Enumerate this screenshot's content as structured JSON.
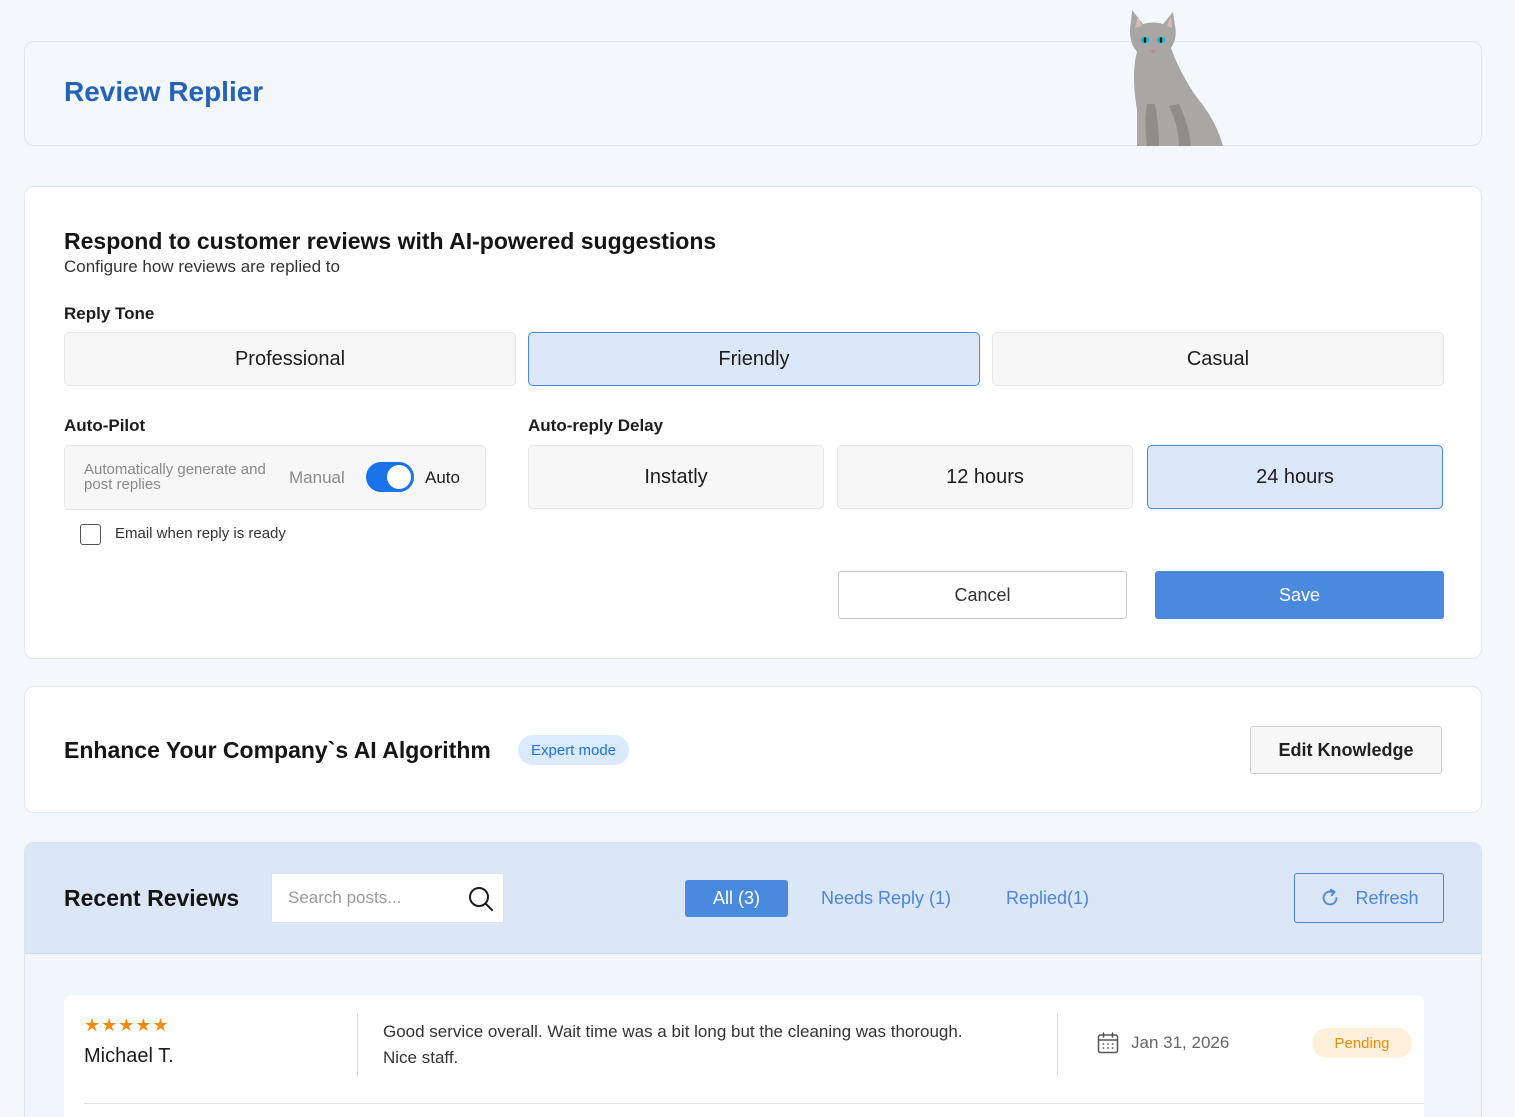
{
  "header": {
    "title": "Review Replier"
  },
  "settings": {
    "title": "Respond to customer reviews with AI-powered suggestions",
    "subtitle": "Configure how reviews are replied to",
    "reply_tone": {
      "label": "Reply Tone",
      "options": [
        "Professional",
        "Friendly",
        "Casual"
      ],
      "selected": "Friendly"
    },
    "auto_pilot": {
      "label": "Auto-Pilot",
      "description": "Automatically generate and post replies",
      "manual_label": "Manual",
      "auto_label": "Auto",
      "enabled": true
    },
    "auto_reply_delay": {
      "label": "Auto-reply Delay",
      "options": [
        "Instatly",
        "12 hours",
        "24 hours"
      ],
      "selected": "24 hours"
    },
    "email_option": {
      "label": "Email when reply is ready",
      "checked": false
    },
    "cancel_label": "Cancel",
    "save_label": "Save"
  },
  "enhance": {
    "title": "Enhance Your Company`s AI Algorithm",
    "badge": "Expert mode",
    "edit_button": "Edit Knowledge"
  },
  "reviews": {
    "title": "Recent Reviews",
    "search_placeholder": "Search posts...",
    "tabs": [
      {
        "label": "All (3)",
        "active": true
      },
      {
        "label": "Needs Reply (1)",
        "active": false
      },
      {
        "label": "Replied(1)",
        "active": false
      }
    ],
    "refresh_label": "Refresh",
    "items": [
      {
        "rating": 5,
        "stars": "★★★★★",
        "author": "Michael T.",
        "text": "Good service overall. Wait time was a bit long but the cleaning was thorough. Nice staff.",
        "date": "Jan 31, 2026",
        "status": "Pending"
      }
    ]
  },
  "colors": {
    "brand_blue": "#2563b8",
    "accent": "#4a8ade",
    "selected_bg": "#dce8fa",
    "star": "#f08a0c",
    "pending_bg": "#fdf1dc"
  }
}
